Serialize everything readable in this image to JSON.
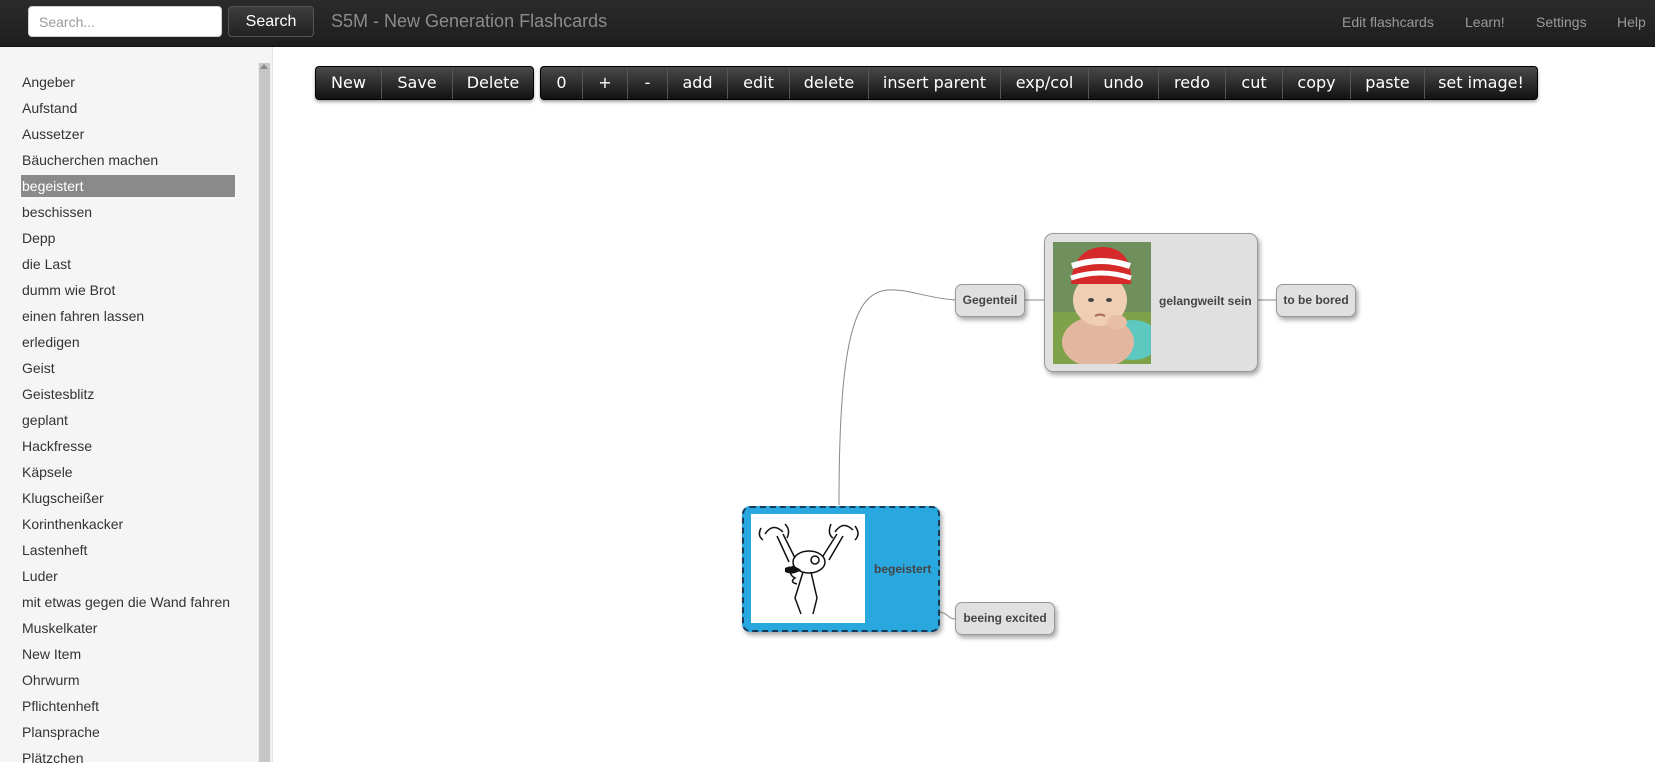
{
  "header": {
    "search_placeholder": "Search...",
    "search_button": "Search",
    "brand": "S5M - New Generation Flashcards",
    "nav": [
      "Edit flashcards",
      "Learn!",
      "Settings",
      "Help"
    ]
  },
  "sidebar": {
    "items": [
      "Angeber",
      "Aufstand",
      "Aussetzer",
      "Bäucherchen machen",
      "begeistert",
      "beschissen",
      "Depp",
      "die Last",
      "dumm wie Brot",
      "einen fahren lassen",
      "erledigen",
      "Geist",
      "Geistesblitz",
      "geplant",
      "Hackfresse",
      "Käpsele",
      "Klugscheißer",
      "Korinthenkacker",
      "Lastenheft",
      "Luder",
      "mit etwas gegen die Wand fahren",
      "Muskelkater",
      "New Item",
      "Ohrwurm",
      "Pflichtenheft",
      "Plansprache",
      "Plätzchen"
    ],
    "selected": "begeistert"
  },
  "toolbar": {
    "file_buttons": [
      "New",
      "Save",
      "Delete"
    ],
    "edit_buttons": [
      "0",
      "+",
      "-",
      "add",
      "edit",
      "delete",
      "insert parent",
      "exp/col",
      "undo",
      "redo",
      "cut",
      "copy",
      "paste",
      "set image!"
    ]
  },
  "mindmap": {
    "nodes": {
      "gegenteil": "Gegenteil",
      "gelangweilt": "gelangweilt sein",
      "bored": "to be bored",
      "begeistert": "begeistert",
      "excited": "beeing excited"
    },
    "images": {
      "gelangweilt": "photo-of-bored-baby",
      "begeistert": "drawing-of-excited-figure"
    },
    "colors": {
      "selected_node": "#29a8e0",
      "node": "#e0e0e0"
    }
  }
}
